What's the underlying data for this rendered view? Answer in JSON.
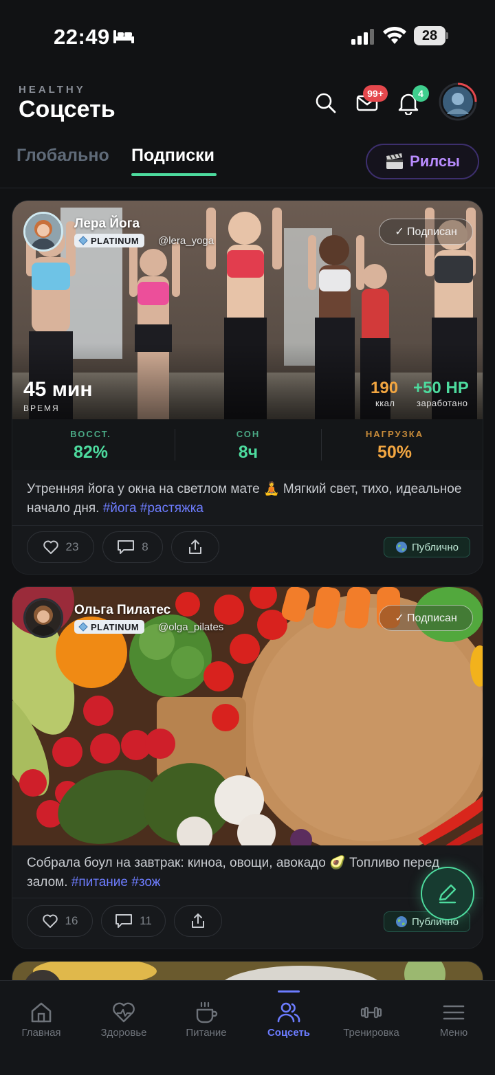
{
  "status_bar": {
    "time": "22:49",
    "battery": "28"
  },
  "header": {
    "brand": "HEALTHY",
    "title": "Соцсеть",
    "messages_badge": "99+",
    "notifications_badge": "4"
  },
  "tabs": [
    {
      "label": "Глобально",
      "active": false
    },
    {
      "label": "Подписки",
      "active": true
    }
  ],
  "reels_button": {
    "label": "Рилсы",
    "icon": "clapperboard-icon"
  },
  "posts": [
    {
      "author": "Лера Йога",
      "tier": "PLATINUM",
      "handle": "@lera_yoga",
      "follow_state": "✓ Подписан",
      "duration_value": "45 мин",
      "duration_label": "ВРЕМЯ",
      "kcal_value": "190",
      "kcal_label": "ккал",
      "hp_value": "+50 HP",
      "hp_label": "заработано",
      "metrics": [
        {
          "label": "ВОССТ.",
          "value": "82%",
          "color": "#4ddb9e"
        },
        {
          "label": "СОН",
          "value": "8ч",
          "color": "#4ddb9e"
        },
        {
          "label": "НАГРУЗКА",
          "value": "50%",
          "color": "#f2a641"
        }
      ],
      "caption_text": "Утренняя йога у окна на светлом мате 🧘 Мягкий свет, тихо, идеальное начало дня.",
      "caption_tags": "#йога #растяжка",
      "likes": "23",
      "comments": "8",
      "visibility": "Публично"
    },
    {
      "author": "Ольга Пилатес",
      "tier": "PLATINUM",
      "handle": "@olga_pilates",
      "follow_state": "✓ Подписан",
      "caption_text": "Собрала боул на завтрак: киноа, овощи, авокадо 🥑 Топливо перед залом.",
      "caption_tags": "#питание #зож",
      "likes": "16",
      "comments": "11",
      "visibility": "Публично"
    }
  ],
  "bottom_nav": [
    {
      "label": "Главная",
      "icon": "home-icon",
      "active": false
    },
    {
      "label": "Здоровье",
      "icon": "heart-pulse-icon",
      "active": false
    },
    {
      "label": "Питание",
      "icon": "cup-icon",
      "active": false
    },
    {
      "label": "Соцсеть",
      "icon": "users-icon",
      "active": true
    },
    {
      "label": "Тренировка",
      "icon": "dumbbell-icon",
      "active": false
    },
    {
      "label": "Меню",
      "icon": "menu-icon",
      "active": false
    }
  ],
  "colors": {
    "accent_green": "#4ddb9e",
    "accent_orange": "#f2a641",
    "accent_purple": "#b98cff",
    "nav_active": "#6c7cff",
    "badge_red": "#e5484d"
  }
}
